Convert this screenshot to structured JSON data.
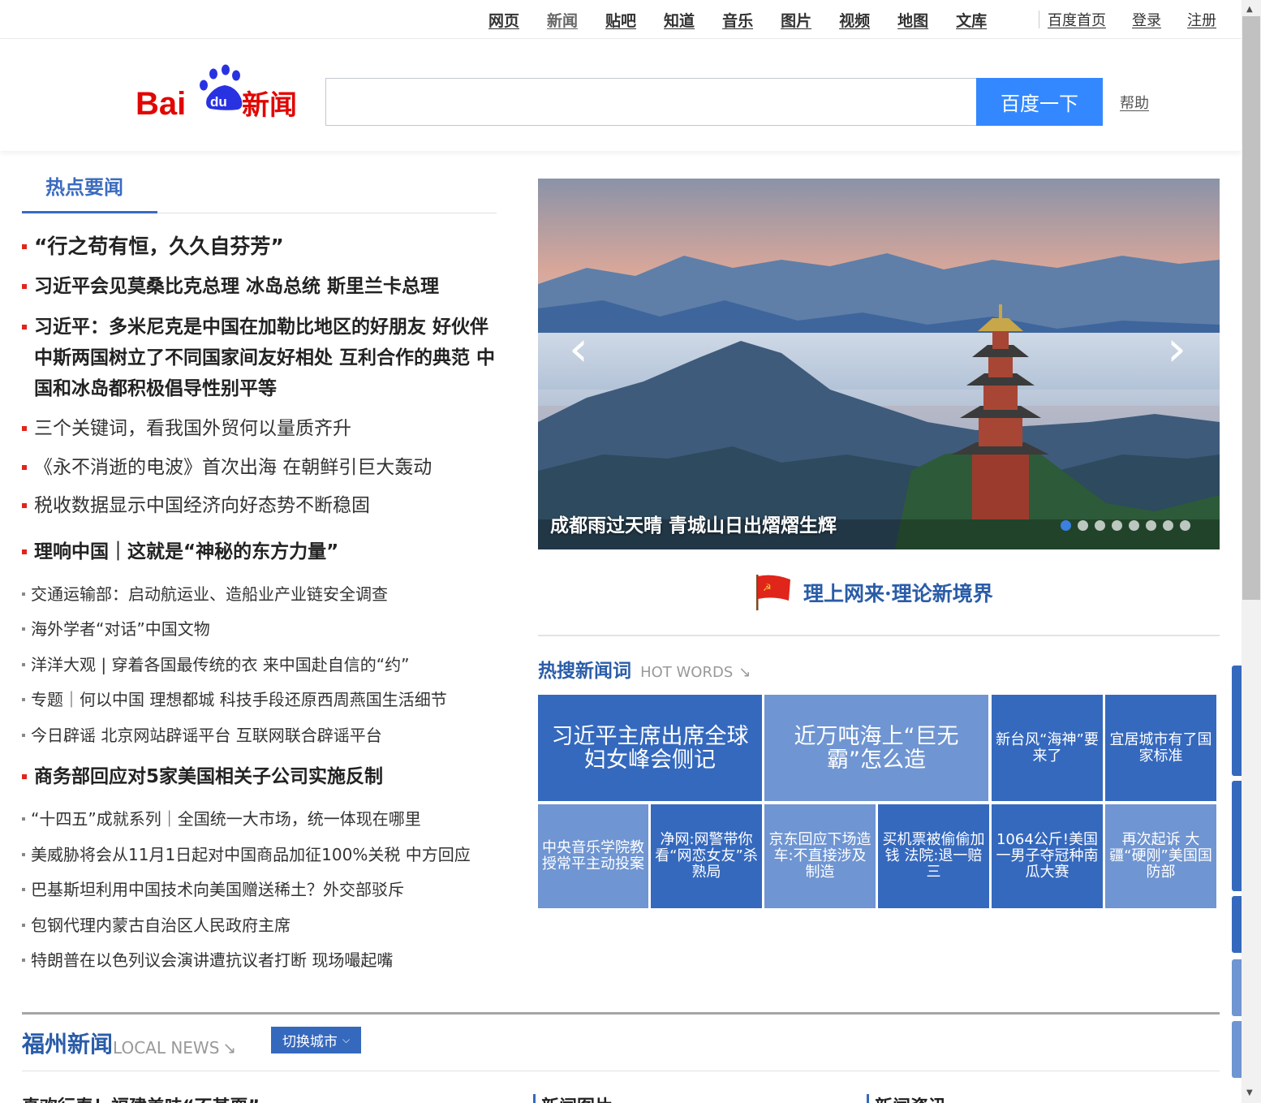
{
  "topnav": {
    "links": [
      "网页",
      "新闻",
      "贴吧",
      "知道",
      "音乐",
      "图片",
      "视频",
      "地图",
      "文库"
    ],
    "right": [
      "百度首页",
      "登录",
      "注册"
    ]
  },
  "header": {
    "logo_text": "Bai du 新闻",
    "search_placeholder": "",
    "search_button": "百度一下",
    "help": "帮助"
  },
  "hot": {
    "title": "热点要闻",
    "items": [
      "“行之苟有恒，久久自芬芳”",
      "习近平会见莫桑比克总理  冰岛总统  斯里兰卡总理",
      "习近平：多米尼克是中国在加勒比地区的好朋友 好伙伴  中斯两国树立了不同国家间友好相处 互利合作的典范  中国和冰岛都积极倡导性别平等",
      "三个关键词，看我国外贸何以量质齐升",
      "《永不消逝的电波》首次出海 在朝鲜引巨大轰动",
      "税收数据显示中国经济向好态势不断稳固",
      "理响中国｜这就是“神秘的东方力量”",
      "交通运输部：启动航运业、造船业产业链安全调查",
      "海外学者“对话”中国文物",
      "洋洋大观 | 穿着各国最传统的衣 来中国赴自信的“约”",
      "专题｜何以中国 理想都城 科技手段还原西周燕国生活细节",
      "今日辟谣 北京网站辟谣平台 互联网联合辟谣平台",
      "商务部回应对5家美国相关子公司实施反制",
      "“十四五”成就系列｜全国统一大市场，统一体现在哪里",
      "美威胁将会从11月1日起对中国商品加征100%关税 中方回应",
      "巴基斯坦利用中国技术向美国赠送稀土？外交部驳斥",
      "包钢代理内蒙古自治区人民政府主席",
      "特朗普在以色列议会演讲遭抗议者打断 现场嘬起嘴"
    ]
  },
  "carousel": {
    "caption": "成都雨过天晴 青城山日出熠熠生辉",
    "prev": "‹",
    "next": "›",
    "dot_count": 8,
    "active_dot": 0
  },
  "theory": {
    "label": "理上网来·理论新境界"
  },
  "hotwords": {
    "title": "热搜新闻词",
    "subtitle": "HOT WORDS",
    "items": [
      "习近平主席出席全球妇女峰会侧记",
      "近万吨海上“巨无霸”怎么造",
      "新台风“海神”要来了",
      "宜居城市有了国家标准",
      "中央音乐学院教授常平主动投案",
      "净网:网警带你看“网恋女友”杀熟局",
      "京东回应下场造车:不直接涉及制造",
      "买机票被偷偷加钱 法院:退一赔三",
      "1064公斤!美国一男子夺冠种南瓜大赛",
      "再次起诉 大疆“硬刚”美国国防部"
    ]
  },
  "local": {
    "title": "福州新闻",
    "subtitle": "LOCAL NEWS",
    "switch": "切换城市",
    "bottom": [
      "真欢行春！福建美味“不甚耍”",
      "新闻图片",
      "新闻资讯"
    ]
  },
  "colors": {
    "accent": "#3b6bbf",
    "button": "#3388ff",
    "bullet": "#e1251b"
  }
}
